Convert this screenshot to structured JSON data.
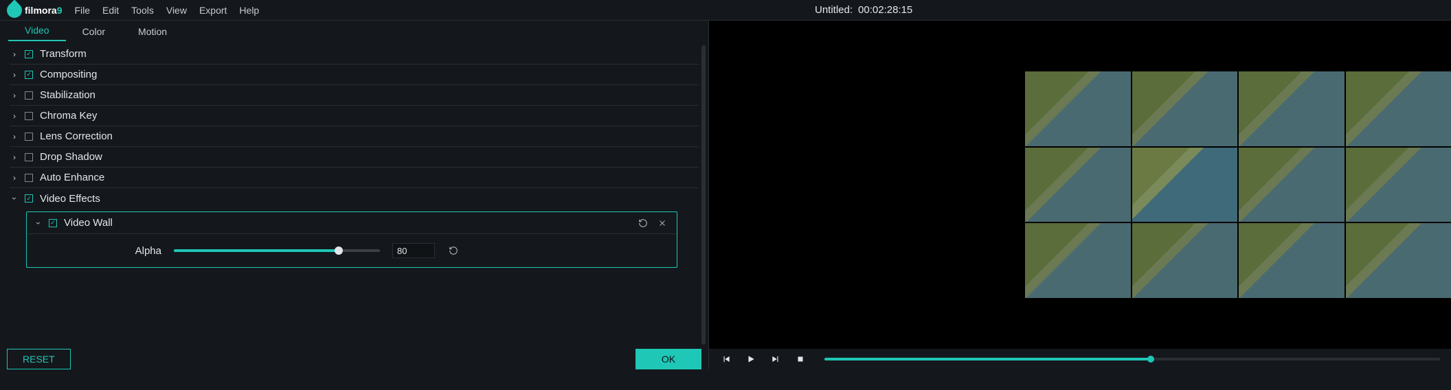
{
  "app": {
    "name": "filmora",
    "version_suffix": "9"
  },
  "menu": {
    "items": [
      "File",
      "Edit",
      "Tools",
      "View",
      "Export",
      "Help"
    ]
  },
  "title": {
    "project": "Untitled:",
    "timecode": "00:02:28:15"
  },
  "tabs": {
    "items": [
      "Video",
      "Color",
      "Motion"
    ],
    "active": 0
  },
  "accordion": {
    "items": [
      {
        "label": "Transform",
        "checked": true,
        "expanded": false
      },
      {
        "label": "Compositing",
        "checked": true,
        "expanded": false
      },
      {
        "label": "Stabilization",
        "checked": false,
        "expanded": false
      },
      {
        "label": "Chroma Key",
        "checked": false,
        "expanded": false
      },
      {
        "label": "Lens Correction",
        "checked": false,
        "expanded": false
      },
      {
        "label": "Drop Shadow",
        "checked": false,
        "expanded": false
      },
      {
        "label": "Auto Enhance",
        "checked": false,
        "expanded": false
      },
      {
        "label": "Video Effects",
        "checked": true,
        "expanded": true
      }
    ],
    "nested": {
      "label": "Video Wall",
      "checked": true,
      "param": {
        "label": "Alpha",
        "value": "80",
        "min": 0,
        "max": 100
      }
    }
  },
  "buttons": {
    "reset": "RESET",
    "ok": "OK"
  },
  "transport": {
    "progress_pct": 53
  },
  "colors": {
    "accent": "#1fc7b6",
    "bg": "#14181c"
  }
}
